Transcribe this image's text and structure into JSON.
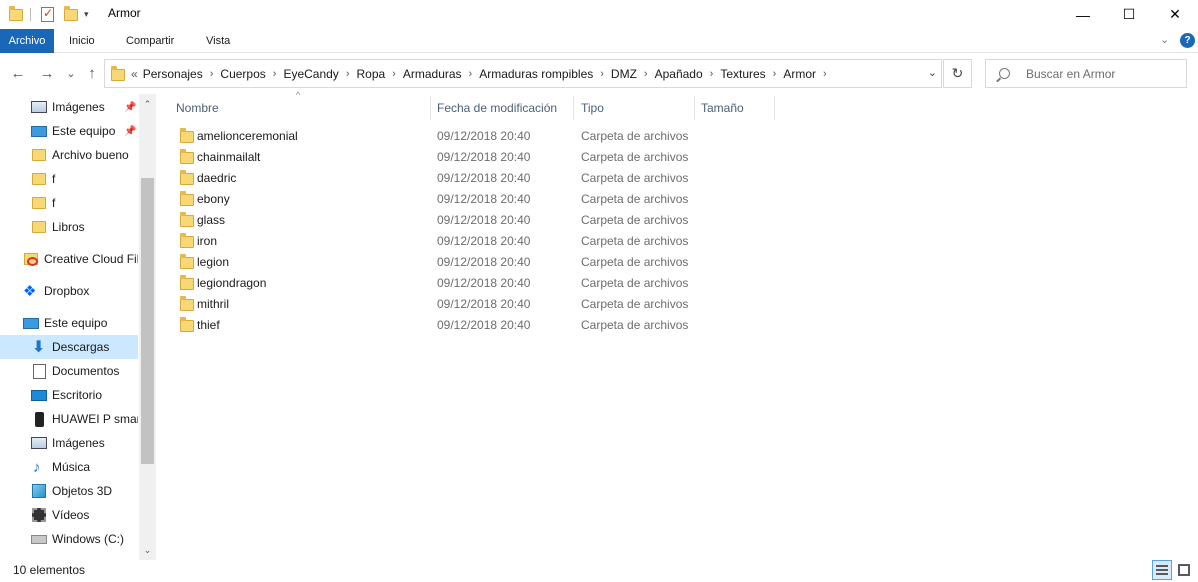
{
  "window": {
    "title": "Armor",
    "minimize_glyph": "—",
    "maximize_glyph": "☐",
    "close_glyph": "✕",
    "qat_dropdown_glyph": "▾"
  },
  "ribbon": {
    "file_label": "Archivo",
    "tabs": [
      "Inicio",
      "Compartir",
      "Vista"
    ],
    "expand_glyph": "⌄",
    "help_glyph": "?"
  },
  "nav": {
    "back_glyph": "←",
    "forward_glyph": "→",
    "recent_glyph": "⌄",
    "up_glyph": "↑",
    "breadcrumb_overflow": "«",
    "breadcrumbs": [
      "Personajes",
      "Cuerpos",
      "EyeCandy",
      "Ropa",
      "Armaduras",
      "Armaduras rompibles",
      "DMZ",
      "Apañado",
      "Textures",
      "Armor"
    ],
    "crumb_separator": "›",
    "address_dropdown_glyph": "⌄",
    "refresh_glyph": "↻",
    "search_placeholder": "Buscar en Armor"
  },
  "navpane": {
    "items": [
      {
        "label": "Imágenes",
        "icon": "pictures-icon",
        "pinned": true
      },
      {
        "label": "Este equipo",
        "icon": "pc-icon",
        "pinned": true
      },
      {
        "label": "Archivo bueno",
        "icon": "folder-icon",
        "pinned": false
      },
      {
        "label": "f",
        "icon": "folder-icon",
        "pinned": false
      },
      {
        "label": "f",
        "icon": "folder-icon",
        "pinned": false
      },
      {
        "label": "Libros",
        "icon": "folder-icon",
        "pinned": false
      },
      {
        "label": "Creative Cloud Fil",
        "icon": "creative-cloud-icon",
        "pinned": false
      },
      {
        "label": "Dropbox",
        "icon": "dropbox-icon",
        "pinned": false
      },
      {
        "label": "Este equipo",
        "icon": "pc-icon",
        "pinned": false
      },
      {
        "label": "Descargas",
        "icon": "downloads-icon",
        "pinned": false,
        "selected": true
      },
      {
        "label": "Documentos",
        "icon": "documents-icon",
        "pinned": false
      },
      {
        "label": "Escritorio",
        "icon": "desktop-icon",
        "pinned": false
      },
      {
        "label": "HUAWEI P smart",
        "icon": "phone-icon",
        "pinned": false
      },
      {
        "label": "Imágenes",
        "icon": "pictures-icon",
        "pinned": false
      },
      {
        "label": "Música",
        "icon": "music-icon",
        "pinned": false
      },
      {
        "label": "Objetos 3D",
        "icon": "3d-objects-icon",
        "pinned": false
      },
      {
        "label": "Vídeos",
        "icon": "videos-icon",
        "pinned": false
      },
      {
        "label": "Windows (C:)",
        "icon": "drive-icon",
        "pinned": false
      }
    ],
    "pin_glyph": "📌",
    "scroll_up_glyph": "⌃",
    "scroll_down_glyph": "⌄"
  },
  "filelist": {
    "columns": [
      "Nombre",
      "Fecha de modificación",
      "Tipo",
      "Tamaño"
    ],
    "sort_glyph": "^",
    "rows": [
      {
        "name": "amelionceremonial",
        "date": "09/12/2018 20:40",
        "type": "Carpeta de archivos"
      },
      {
        "name": "chainmailalt",
        "date": "09/12/2018 20:40",
        "type": "Carpeta de archivos"
      },
      {
        "name": "daedric",
        "date": "09/12/2018 20:40",
        "type": "Carpeta de archivos"
      },
      {
        "name": "ebony",
        "date": "09/12/2018 20:40",
        "type": "Carpeta de archivos"
      },
      {
        "name": "glass",
        "date": "09/12/2018 20:40",
        "type": "Carpeta de archivos"
      },
      {
        "name": "iron",
        "date": "09/12/2018 20:40",
        "type": "Carpeta de archivos"
      },
      {
        "name": "legion",
        "date": "09/12/2018 20:40",
        "type": "Carpeta de archivos"
      },
      {
        "name": "legiondragon",
        "date": "09/12/2018 20:40",
        "type": "Carpeta de archivos"
      },
      {
        "name": "mithril",
        "date": "09/12/2018 20:40",
        "type": "Carpeta de archivos"
      },
      {
        "name": "thief",
        "date": "09/12/2018 20:40",
        "type": "Carpeta de archivos"
      }
    ]
  },
  "statusbar": {
    "item_count": "10 elementos"
  },
  "colors": {
    "accent": "#1a66b7",
    "selection": "#cce8ff",
    "folder": "#f8d775"
  }
}
